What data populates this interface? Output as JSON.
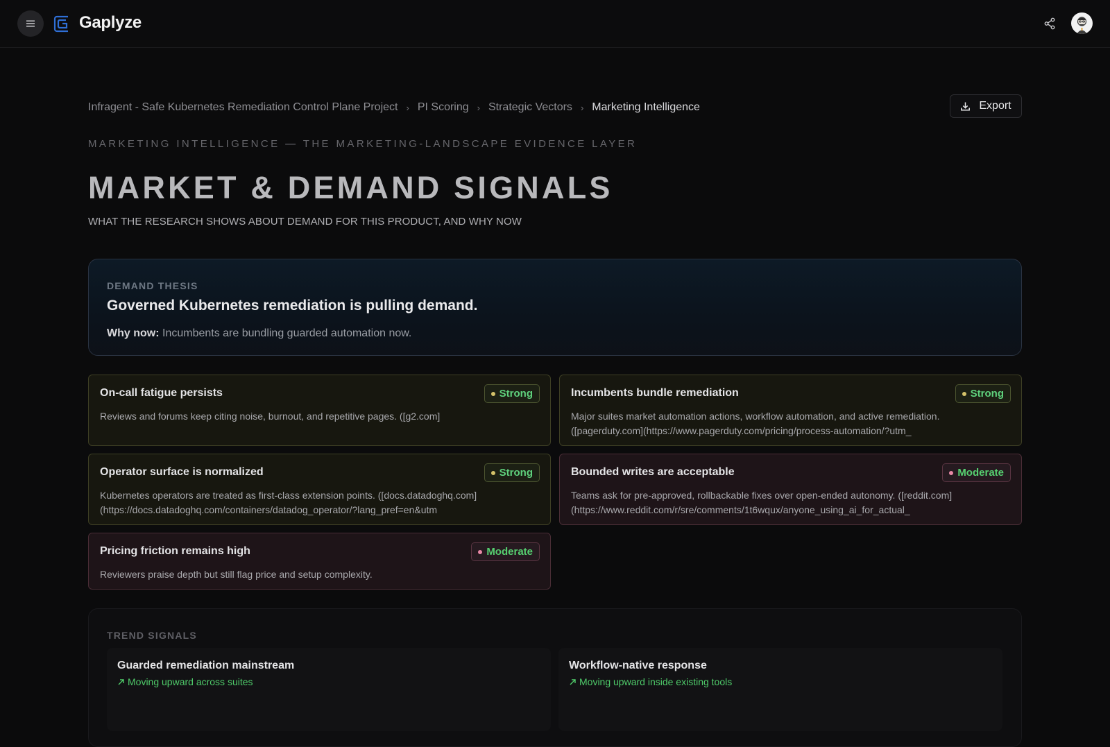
{
  "app": {
    "name": "Gaplyze"
  },
  "breadcrumb": [
    "Infragent - Safe Kubernetes Remediation Control Plane Project",
    "PI Scoring",
    "Strategic Vectors",
    "Marketing Intelligence"
  ],
  "toolbar": {
    "export_label": "Export"
  },
  "header": {
    "eyebrow": "MARKETING INTELLIGENCE — THE MARKETING-LANDSCAPE EVIDENCE LAYER",
    "title": "MARKET & DEMAND SIGNALS",
    "subtitle": "WHAT THE RESEARCH SHOWS ABOUT DEMAND FOR THIS PRODUCT, AND WHY NOW"
  },
  "thesis": {
    "label": "DEMAND THESIS",
    "headline": "Governed Kubernetes remediation is pulling demand.",
    "why_label": "Why now:",
    "why_text": "Incumbents are bundling guarded automation now."
  },
  "signals": [
    {
      "title": "On-call fatigue persists",
      "strength": "Strong",
      "body": "Reviews and forums keep citing noise, burnout, and repetitive pages. ([g2.com]"
    },
    {
      "title": "Incumbents bundle remediation",
      "strength": "Strong",
      "body": "Major suites market automation actions, workflow automation, and active remediation. ([pagerduty.com](https://www.pagerduty.com/pricing/process-automation/?utm_"
    },
    {
      "title": "Operator surface is normalized",
      "strength": "Strong",
      "body": "Kubernetes operators are treated as first-class extension points. ([docs.datadoghq.com](https://docs.datadoghq.com/containers/datadog_operator/?lang_pref=en&utm"
    },
    {
      "title": "Bounded writes are acceptable",
      "strength": "Moderate",
      "body": "Teams ask for pre-approved, rollbackable fixes over open-ended autonomy. ([reddit.com](https://www.reddit.com/r/sre/comments/1t6wqux/anyone_using_ai_for_actual_"
    },
    {
      "title": "Pricing friction remains high",
      "strength": "Moderate",
      "body": "Reviewers praise depth but still flag price and setup complexity."
    }
  ],
  "trends": {
    "label": "TREND SIGNALS",
    "items": [
      {
        "title": "Guarded remediation mainstream",
        "direction": "Moving upward across suites"
      },
      {
        "title": "Workflow-native response",
        "direction": "Moving upward inside existing tools"
      }
    ]
  },
  "icons": {
    "menu": "menu-icon",
    "logo": "gaplyze-logo-icon",
    "share": "share-icon",
    "export": "download-icon",
    "chevron": "chevron-right-icon",
    "trend_up": "arrow-up-right-icon"
  },
  "colors": {
    "background": "#0b0b0c",
    "accent_blue": "#2f6fd6",
    "strong_badge_text": "#5fd17d",
    "moderate_badge_dot": "#e888a6",
    "trend_text": "#4fcb6a"
  }
}
